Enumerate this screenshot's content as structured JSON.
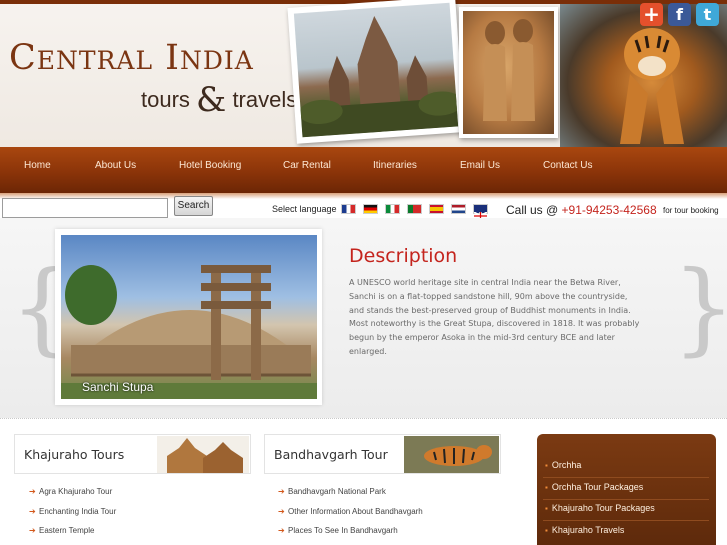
{
  "logo": {
    "main": "Central India",
    "sub_left": "tours",
    "amp": "&",
    "sub_right": "travels"
  },
  "social": [
    {
      "icon": "plus-share-icon",
      "glyph": "+"
    },
    {
      "icon": "facebook-icon",
      "glyph": "f"
    },
    {
      "icon": "twitter-icon",
      "glyph": "t"
    }
  ],
  "nav": [
    "Home",
    "About Us",
    "Hotel Booking",
    "Car Rental",
    "Itineraries",
    "Email Us",
    "Contact Us"
  ],
  "search": {
    "value": "",
    "placeholder": "",
    "button": "Search"
  },
  "language": {
    "label": "Select language",
    "flags": [
      "france-flag-icon",
      "germany-flag-icon",
      "italy-flag-icon",
      "portugal-flag-icon",
      "spain-flag-icon",
      "netherlands-flag-icon",
      "uk-flag-icon"
    ]
  },
  "call": {
    "prefix": "Call us @ ",
    "phone": "+91-94253-42568",
    "suffix": "for tour booking"
  },
  "slide": {
    "caption": "Sanchi Stupa",
    "title": "Description",
    "body": "A UNESCO world heritage site in central India near the Betwa River, Sanchi is on a flat-topped sandstone hill, 90m above the countryside, and stands the best-preserved group of Buddhist monuments in India. Most noteworthy is the Great Stupa, discovered in 1818. It was probably begun by the emperor Asoka in the mid-3rd century BCE and later enlarged."
  },
  "box1": {
    "title": "Khajuraho Tours",
    "items": [
      "Agra Khajuraho Tour",
      "Enchanting India Tour",
      "Eastern Temple"
    ]
  },
  "box2": {
    "title": "Bandhavgarh Tour",
    "items": [
      "Bandhavgarh National Park",
      "Other Information About Bandhavgarh",
      "Places To See In Bandhavgarh"
    ]
  },
  "side_links": [
    "Orchha",
    "Orchha Tour Packages",
    "Khajuraho Tour Packages",
    "Khajuraho Travels"
  ],
  "colors": {
    "brand": "#7b3512",
    "nav": "#8b3409",
    "accent_red": "#c4241d"
  }
}
